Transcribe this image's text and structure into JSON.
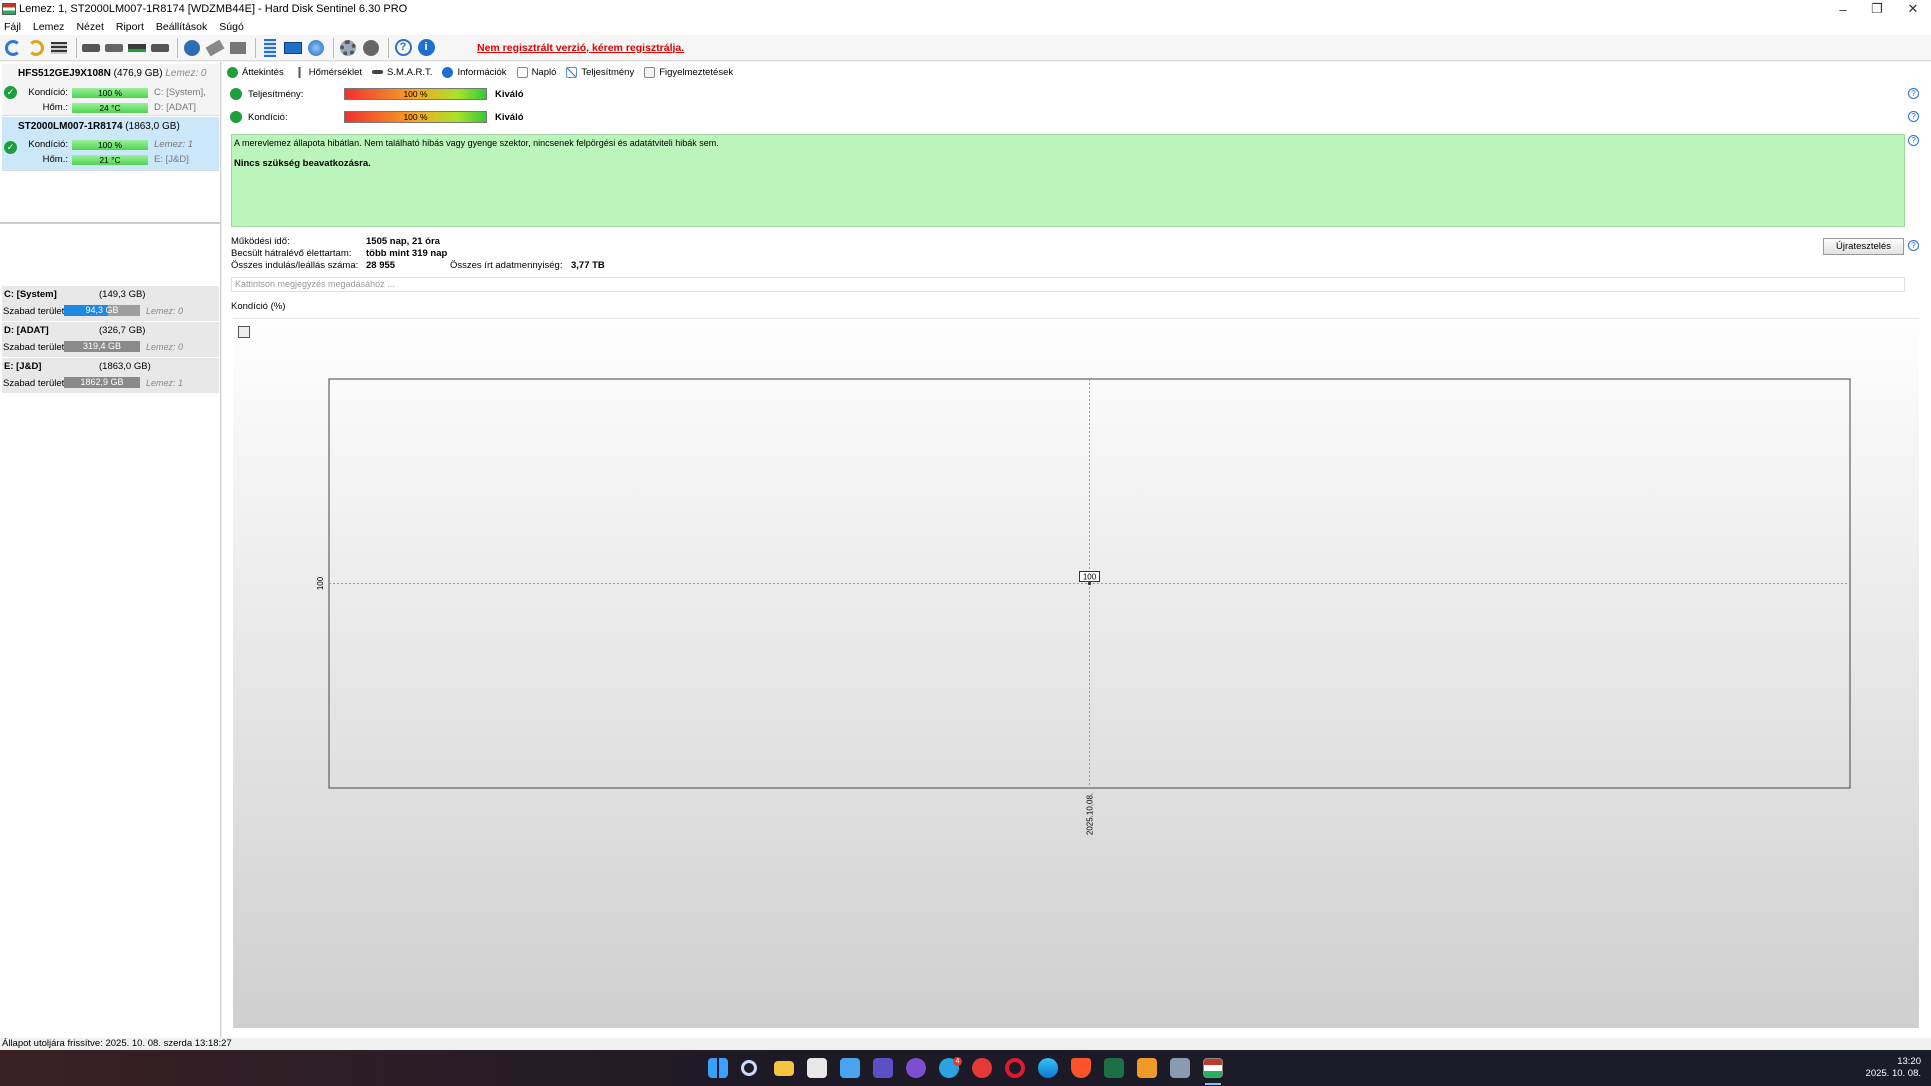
{
  "window": {
    "title": "Lemez: 1, ST2000LM007-1R8174 [WDZMB44E]  -  Hard Disk Sentinel 6.30 PRO"
  },
  "menu": [
    "Fájl",
    "Lemez",
    "Nézet",
    "Riport",
    "Beállítások",
    "Súgó"
  ],
  "toolbar": {
    "unregistered": "Nem regisztrált verzió, kérem regisztrálja."
  },
  "disks": [
    {
      "name": "HFS512GEJ9X108N",
      "size": "(476,9 GB)",
      "index": "Lemez: 0",
      "cond_label": "Kondíció:",
      "cond": "100 %",
      "cond_side": "C: [System],",
      "temp_label": "Hőm.:",
      "temp": "24 °C",
      "temp_side": "D: [ADAT]"
    },
    {
      "name": "ST2000LM007-1R8174",
      "size": "(1863,0 GB)",
      "cond_label": "Kondíció:",
      "cond": "100 %",
      "cond_side": "Lemez: 1",
      "temp_label": "Hőm.:",
      "temp": "21 °C",
      "temp_side": "E: [J&D]"
    }
  ],
  "partitions": [
    {
      "name": "C: [System]",
      "size": "(149,3 GB)",
      "free_label": "Szabad terület",
      "free": "94,3 GB",
      "disk": "Lemez: 0"
    },
    {
      "name": "D: [ADAT]",
      "size": "(326,7 GB)",
      "free_label": "Szabad terület",
      "free": "319,4 GB",
      "disk": "Lemez: 0"
    },
    {
      "name": "E: [J&D]",
      "size": "(1863,0 GB)",
      "free_label": "Szabad terület",
      "free": "1862,9 GB",
      "disk": "Lemez: 1"
    }
  ],
  "tabs": [
    "Áttekintés",
    "Hőmérséklet",
    "S.M.A.R.T.",
    "Információk",
    "Napló",
    "Teljesítmény",
    "Figyelmeztetések"
  ],
  "overview": {
    "perf_label": "Teljesítmény:",
    "perf_value": "100 %",
    "perf_rating": "Kiváló",
    "cond_label": "Kondíció:",
    "cond_value": "100 %",
    "cond_rating": "Kiváló",
    "message": "A merevlemez állapota hibátlan. Nem található hibás vagy gyenge szektor, nincsenek felpörgési és adatátviteli hibák sem.",
    "action": "Nincs szükség beavatkozásra.",
    "uptime_label": "Működési idő:",
    "uptime": "1505 nap, 21 óra",
    "life_label": "Becsült hátralévő élettartam:",
    "life": "több mint 319 nap",
    "starts_label": "Összes indulás/leállás száma:",
    "starts": "28 955",
    "written_label": "Összes írt adatmennyiség:",
    "written": "3,77 TB",
    "retest": "Újratesztelés",
    "note_placeholder": "Kattintson megjegyzés megadásához ..."
  },
  "chart_tab": "Kondíció  (%)",
  "chart_data": {
    "type": "line",
    "x": [
      "2025.10.08"
    ],
    "series": [
      {
        "values": [
          100
        ]
      }
    ],
    "y_tick": "100",
    "x_tick": "2025.10.08.",
    "point_label": "100"
  },
  "statusbar": "Állapot utoljára frissítve: 2025. 10. 08. szerda 13:18:27",
  "clock": {
    "time": "13:20",
    "date": "2025. 10. 08."
  },
  "taskbar_badge": "4"
}
